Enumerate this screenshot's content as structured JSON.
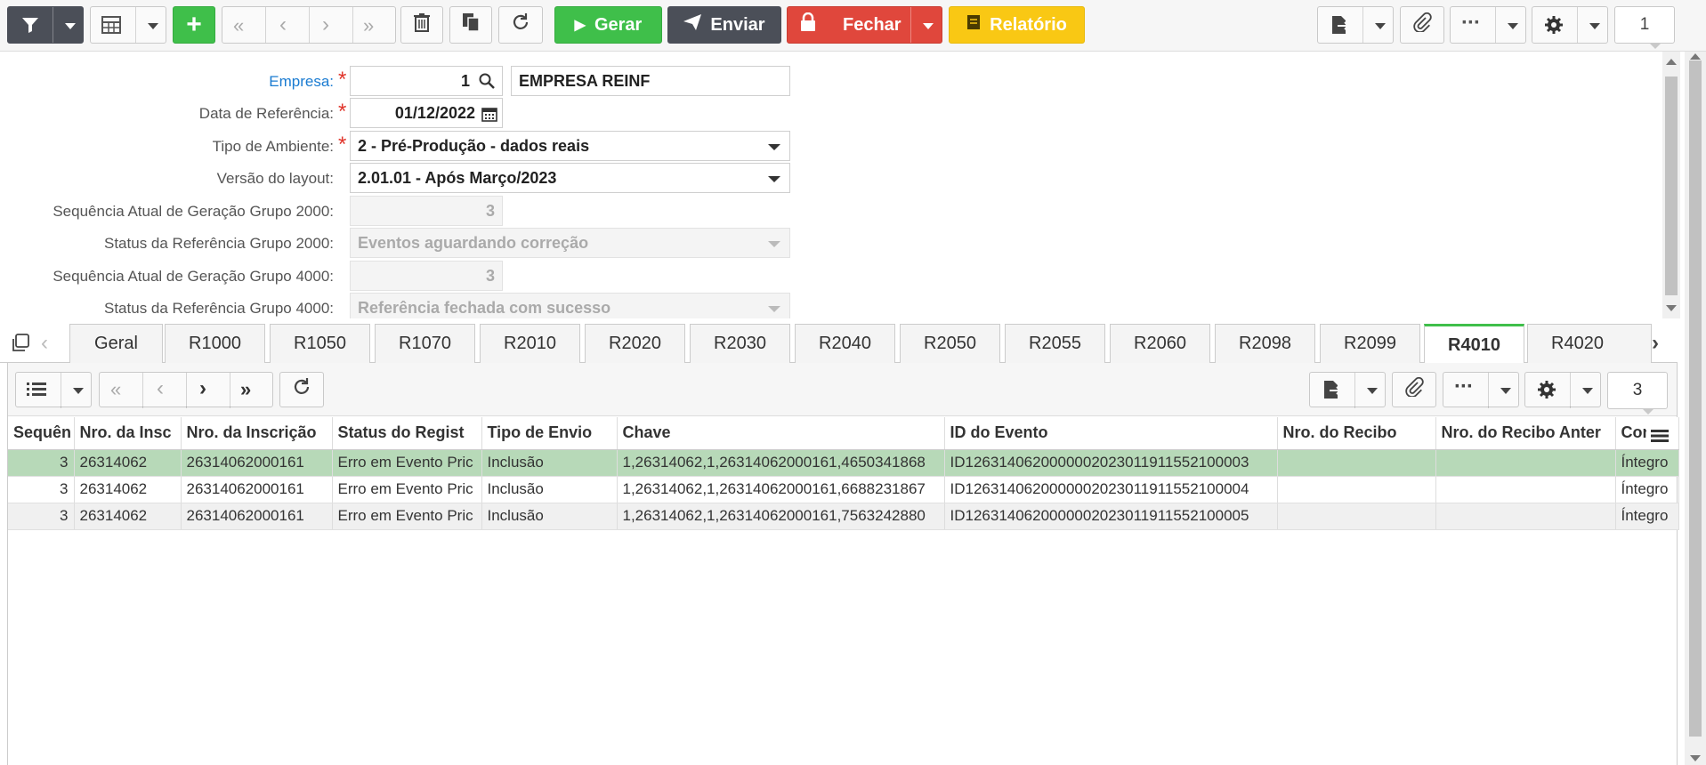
{
  "toolbar": {
    "gerar_label": "Gerar",
    "enviar_label": "Enviar",
    "fechar_label": "Fechar",
    "relatorio_label": "Relatório",
    "page_number": "1"
  },
  "form": {
    "empresa_label": "Empresa:",
    "empresa_code": "1",
    "empresa_name": "EMPRESA REINF",
    "data_ref_label": "Data de Referência:",
    "data_ref_value": "01/12/2022",
    "tipo_amb_label": "Tipo de Ambiente:",
    "tipo_amb_value": "2 - Pré-Produção - dados reais",
    "versao_label": "Versão do layout:",
    "versao_value": "2.01.01 - Após Março/2023",
    "seq2000_label": "Sequência Atual de Geração Grupo 2000:",
    "seq2000_value": "3",
    "status2000_label": "Status da Referência Grupo 2000:",
    "status2000_value": "Eventos aguardando correção",
    "seq4000_label": "Sequência Atual de Geração Grupo 4000:",
    "seq4000_value": "3",
    "status4000_label": "Status da Referência Grupo 4000:",
    "status4000_value": "Referência fechada com sucesso"
  },
  "tabs": [
    "Geral",
    "R1000",
    "R1050",
    "R1070",
    "R2010",
    "R2020",
    "R2030",
    "R2040",
    "R2050",
    "R2055",
    "R2060",
    "R2098",
    "R2099",
    "R4010",
    "R4020"
  ],
  "active_tab": "R4010",
  "grid": {
    "page_number": "3",
    "columns": [
      "Sequên",
      "Nro. da Insc",
      "Nro. da Inscrição",
      "Status do Regist",
      "Tipo de Envio",
      "Chave",
      "ID do Evento",
      "Nro. do Recibo",
      "Nro. do Recibo Anter",
      "Con"
    ],
    "rows": [
      [
        "3",
        "26314062",
        "26314062000161",
        "Erro em Evento Pric",
        "Inclusão",
        "1,26314062,1,26314062000161,4650341868",
        "ID1263140620000002023011911552100003",
        "",
        "",
        "Íntegro"
      ],
      [
        "3",
        "26314062",
        "26314062000161",
        "Erro em Evento Pric",
        "Inclusão",
        "1,26314062,1,26314062000161,6688231867",
        "ID1263140620000002023011911552100004",
        "",
        "",
        "Íntegro"
      ],
      [
        "3",
        "26314062",
        "26314062000161",
        "Erro em Evento Pric",
        "Inclusão",
        "1,26314062,1,26314062000161,7563242880",
        "ID1263140620000002023011911552100005",
        "",
        "",
        "Íntegro"
      ]
    ]
  },
  "colors": {
    "green": "#3fbf4a",
    "dark": "#4b4f58",
    "red": "#e0473c",
    "yellow": "#f9c814",
    "selected_row": "#b7d9b8",
    "link_blue": "#1a7bd1"
  }
}
